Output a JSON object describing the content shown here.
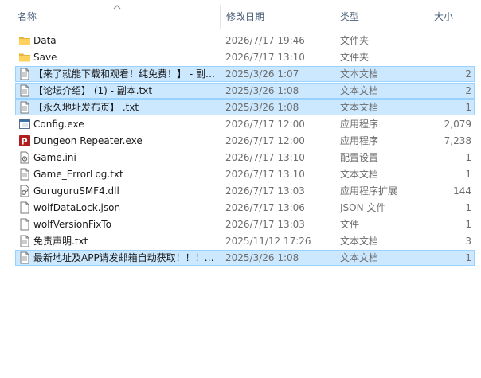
{
  "columns": {
    "name": "名称",
    "date": "修改日期",
    "type": "类型",
    "size": "大小"
  },
  "colors": {
    "selection_bg": "#cce8ff",
    "selection_border": "#99d1ff",
    "header_text": "#4c607a",
    "secondary_text": "#6d6d6d"
  },
  "files": [
    {
      "name": "Data",
      "date": "2026/7/17 19:46",
      "type": "文件夹",
      "size": "",
      "icon": "folder-icon",
      "selected": false
    },
    {
      "name": "Save",
      "date": "2026/7/17 13:10",
      "type": "文件夹",
      "size": "",
      "icon": "folder-icon",
      "selected": false
    },
    {
      "name": "【来了就能下载和观看！纯免费！】 - 副…",
      "date": "2025/3/26 1:07",
      "type": "文本文档",
      "size": "2",
      "icon": "text-file-icon",
      "selected": true
    },
    {
      "name": "【论坛介绍】 (1) - 副本.txt",
      "date": "2025/3/26 1:08",
      "type": "文本文档",
      "size": "2",
      "icon": "text-file-icon",
      "selected": true
    },
    {
      "name": "【永久地址发布页】 .txt",
      "date": "2025/3/26 1:08",
      "type": "文本文档",
      "size": "1",
      "icon": "text-file-icon",
      "selected": true
    },
    {
      "name": "Config.exe",
      "date": "2026/7/17 12:00",
      "type": "应用程序",
      "size": "2,079",
      "icon": "config-app-icon",
      "selected": false
    },
    {
      "name": "Dungeon Repeater.exe",
      "date": "2026/7/17 12:00",
      "type": "应用程序",
      "size": "7,238",
      "icon": "game-app-icon",
      "selected": false
    },
    {
      "name": "Game.ini",
      "date": "2026/7/17 13:10",
      "type": "配置设置",
      "size": "1",
      "icon": "settings-file-icon",
      "selected": false
    },
    {
      "name": "Game_ErrorLog.txt",
      "date": "2026/7/17 13:10",
      "type": "文本文档",
      "size": "1",
      "icon": "text-file-icon",
      "selected": false
    },
    {
      "name": "GuruguruSMF4.dll",
      "date": "2026/7/17 13:03",
      "type": "应用程序扩展",
      "size": "144",
      "icon": "dll-file-icon",
      "selected": false
    },
    {
      "name": "wolfDataLock.json",
      "date": "2026/7/17 13:06",
      "type": "JSON 文件",
      "size": "1",
      "icon": "blank-file-icon",
      "selected": false
    },
    {
      "name": "wolfVersionFixTo",
      "date": "2026/7/17 13:03",
      "type": "文件",
      "size": "1",
      "icon": "blank-file-icon",
      "selected": false
    },
    {
      "name": "免责声明.txt",
      "date": "2025/11/12 17:26",
      "type": "文本文档",
      "size": "3",
      "icon": "text-file-icon",
      "selected": false
    },
    {
      "name": "最新地址及APP请发邮箱自动获取！！！…",
      "date": "2025/3/26 1:08",
      "type": "文本文档",
      "size": "1",
      "icon": "text-file-icon",
      "selected": true
    }
  ]
}
